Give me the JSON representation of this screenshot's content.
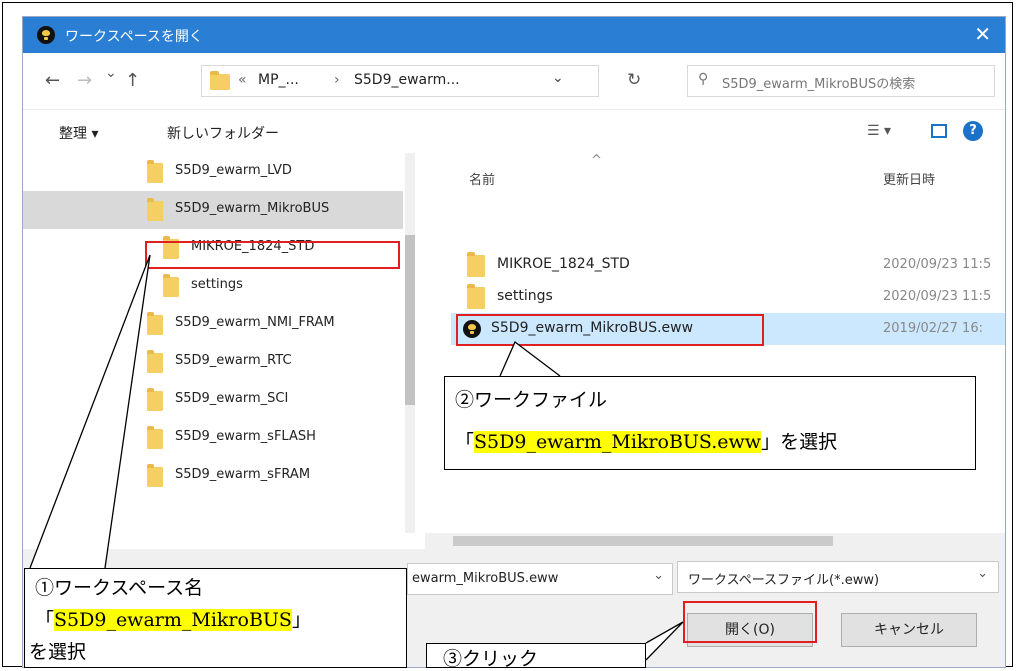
{
  "dialog": {
    "title": "ワークスペースを開く",
    "close_glyph": "✕"
  },
  "address": {
    "back_glyph": "←",
    "forward_glyph": "→",
    "history_glyph": "⌄",
    "up_glyph": "↑",
    "crumb_prefix": "«",
    "crumb_1": "MP_...",
    "crumb_sep": "›",
    "crumb_2": "S5D9_ewarm...",
    "dropdown_glyph": "⌄",
    "refresh_glyph": "↻",
    "search_placeholder": "S5D9_ewarm_MikroBUSの検索",
    "search_glyph": "⚲"
  },
  "toolbar": {
    "organize_label": "整理 ▾",
    "new_folder_label": "新しいフォルダー",
    "view_glyph": "☰ ▾",
    "help_glyph": "?"
  },
  "nav_pane": {
    "items": [
      {
        "label": "S5D9_ewarm_LVD"
      },
      {
        "label": "S5D9_ewarm_MikroBUS"
      },
      {
        "label": "MIKROE_1824_STD"
      },
      {
        "label": "settings"
      },
      {
        "label": "S5D9_ewarm_NMI_FRAM"
      },
      {
        "label": "S5D9_ewarm_RTC"
      },
      {
        "label": "S5D9_ewarm_SCI"
      },
      {
        "label": "S5D9_ewarm_sFLASH"
      },
      {
        "label": "S5D9_ewarm_sFRAM"
      }
    ]
  },
  "file_list": {
    "col_name": "名前",
    "col_date": "更新日時",
    "rows": [
      {
        "name": "MIKROE_1824_STD",
        "date": "2020/09/23 11:5"
      },
      {
        "name": "settings",
        "date": "2020/09/23 11:5"
      },
      {
        "name": "S5D9_ewarm_MikroBUS.eww",
        "date": "2019/02/27 16:"
      }
    ]
  },
  "footer": {
    "filename_value": "ewarm_MikroBUS.eww",
    "filetype_value": "ワークスペースファイル(*.eww)",
    "open_label": "開く(O)",
    "cancel_label": "キャンセル"
  },
  "annotations": {
    "callout1_line1": "①ワークスペース名",
    "callout1_q_open": "「",
    "callout1_hl": "S5D9_ewarm_MikroBUS",
    "callout1_q_close": "」",
    "callout1_line3": "を選択",
    "callout2_line1": "②ワークファイル",
    "callout2_q_open": "「",
    "callout2_hl": "S5D9_ewarm_MikroBUS.eww",
    "callout2_q_close": "」を選択",
    "callout3_text": "③クリック"
  },
  "colors": {
    "titlebar": "#2a7fd4",
    "highlight": "#ffff00",
    "red_box": "#e02020",
    "selected_row": "#cce8ff"
  }
}
